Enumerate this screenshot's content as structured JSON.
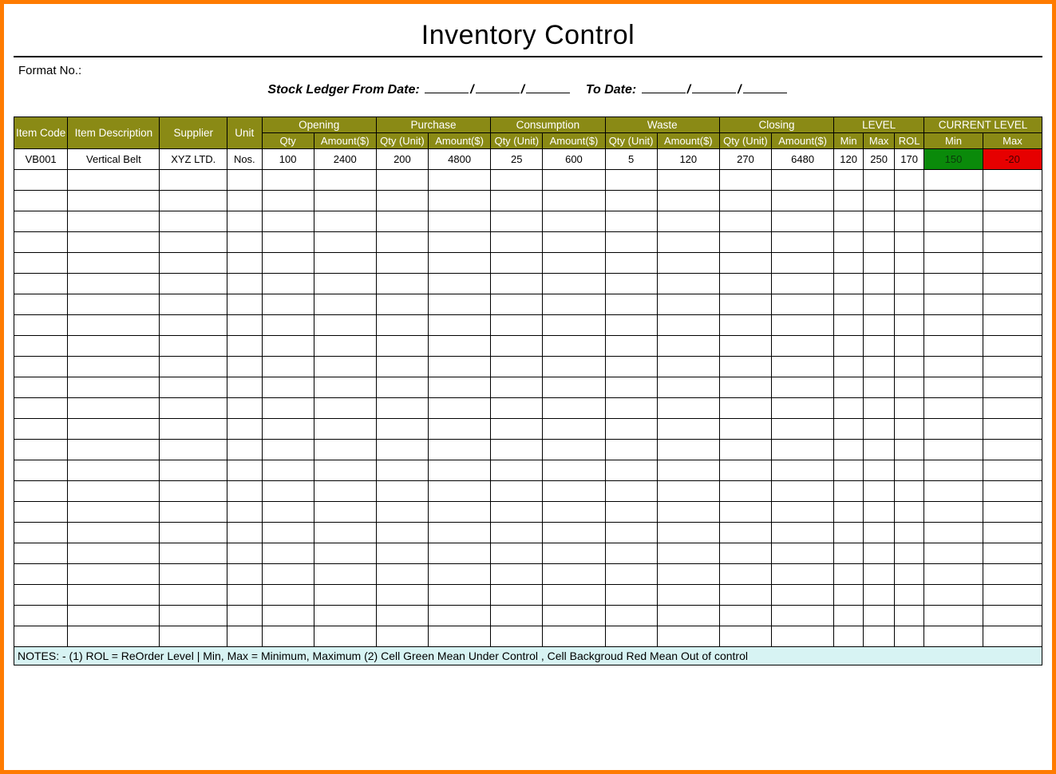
{
  "title": "Inventory Control",
  "format_label": "Format No.:",
  "ledger": {
    "from_label": "Stock Ledger From Date:",
    "to_label": "To Date:",
    "sep": "/"
  },
  "headers": {
    "item_code": "Item Code",
    "item_desc": "Item Description",
    "supplier": "Supplier",
    "unit": "Unit",
    "opening": "Opening",
    "purchase": "Purchase",
    "consumption": "Consumption",
    "waste": "Waste",
    "closing": "Closing",
    "level": "LEVEL",
    "current_level": "CURRENT LEVEL",
    "qty": "Qty",
    "qty_unit": "Qty (Unit)",
    "amount": "Amount($)",
    "min": "Min",
    "max": "Max",
    "rol": "ROL"
  },
  "rows": [
    {
      "item_code": "VB001",
      "item_desc": "Vertical Belt",
      "supplier": "XYZ LTD.",
      "unit": "Nos.",
      "opening_qty": "100",
      "opening_amt": "2400",
      "purchase_qty": "200",
      "purchase_amt": "4800",
      "consumption_qty": "25",
      "consumption_amt": "600",
      "waste_qty": "5",
      "waste_amt": "120",
      "closing_qty": "270",
      "closing_amt": "6480",
      "level_min": "120",
      "level_max": "250",
      "level_rol": "170",
      "current_min": "150",
      "current_max": "-20",
      "current_min_status": "green",
      "current_max_status": "red"
    }
  ],
  "blank_row_count": 23,
  "notes": "NOTES: - (1) ROL = ReOrder Level | Min, Max = Minimum, Maximum     (2) Cell Green Mean Under Control , Cell Backgroud Red Mean Out of control"
}
